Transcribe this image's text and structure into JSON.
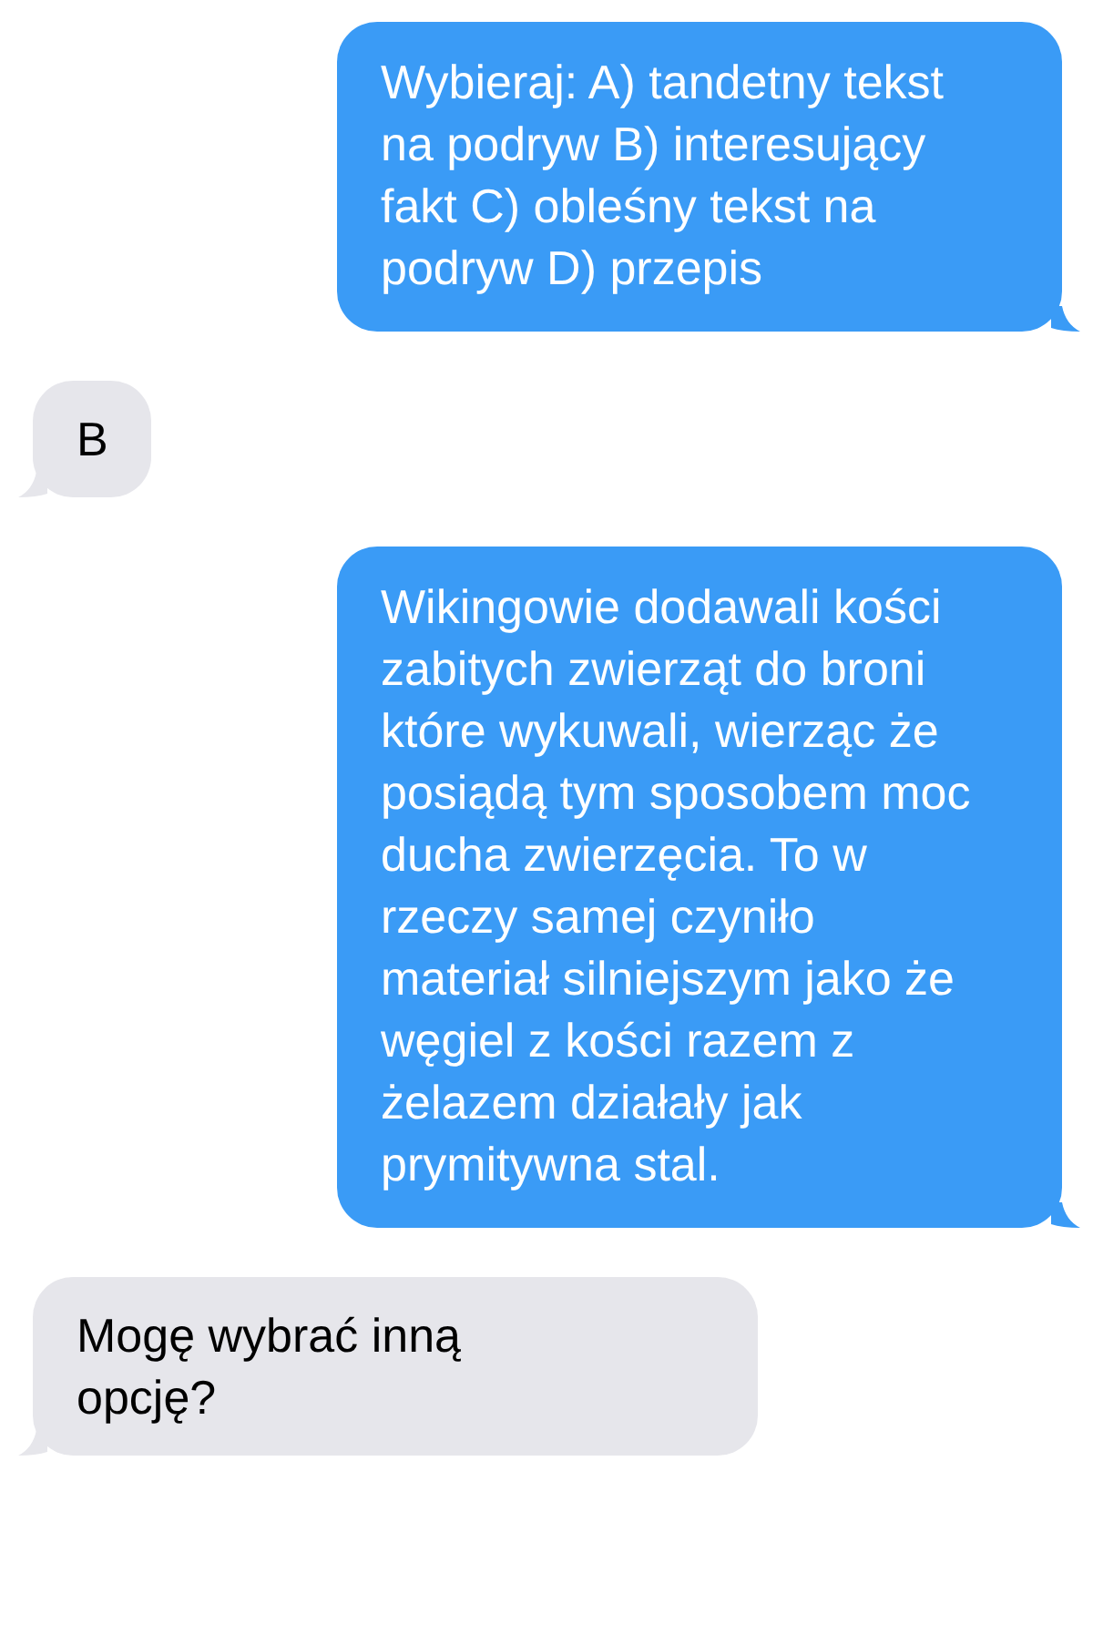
{
  "messages": [
    {
      "kind": "sent",
      "text": "Wybieraj: A) tandetny tekst na podryw B) interesujący fakt C) obleśny tekst na podryw D) przepis"
    },
    {
      "kind": "received",
      "text": "B"
    },
    {
      "kind": "sent",
      "text": "Wikingowie dodawali kości zabitych zwierząt do broni które wykuwali, wierząc że posiądą tym sposobem moc ducha zwierzęcia. To w rzeczy samej czyniło materiał silniejszym jako że węgiel z kości razem z żelazem działały jak prymitywna stal."
    },
    {
      "kind": "received",
      "text": "Mogę wybrać inną opcję?"
    }
  ]
}
